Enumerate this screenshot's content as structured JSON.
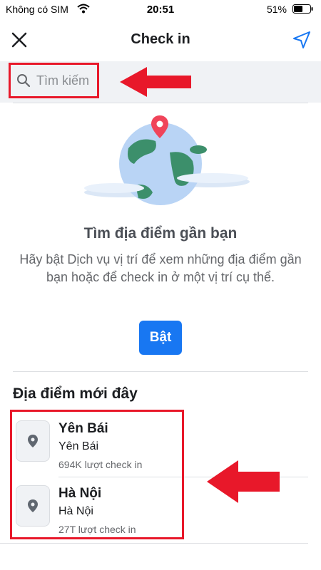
{
  "status_bar": {
    "carrier": "Không có SIM",
    "time": "20:51",
    "battery": "51%"
  },
  "nav": {
    "title": "Check in",
    "close_icon": "close-icon",
    "location_icon": "location-arrow-icon"
  },
  "search": {
    "placeholder": "Tìm kiếm",
    "icon": "search-icon"
  },
  "empty_state": {
    "title": "Tìm địa điểm gần bạn",
    "description": "Hãy bật Dịch vụ vị trí để xem những địa điểm gần bạn hoặc để check in ở một vị trí cụ thể.",
    "button_label": "Bật"
  },
  "recent": {
    "section_title": "Địa điểm mới đây",
    "items": [
      {
        "name": "Yên Bái",
        "subtitle": "Yên Bái",
        "checkins": "694K lượt check in",
        "icon": "map-pin-icon"
      },
      {
        "name": "Hà Nội",
        "subtitle": "Hà Nội",
        "checkins": "27T lượt check in",
        "icon": "map-pin-icon"
      }
    ]
  },
  "colors": {
    "accent": "#1877f2",
    "annotation": "#e8182a",
    "text_primary": "#1c1e21",
    "text_secondary": "#65676b"
  }
}
